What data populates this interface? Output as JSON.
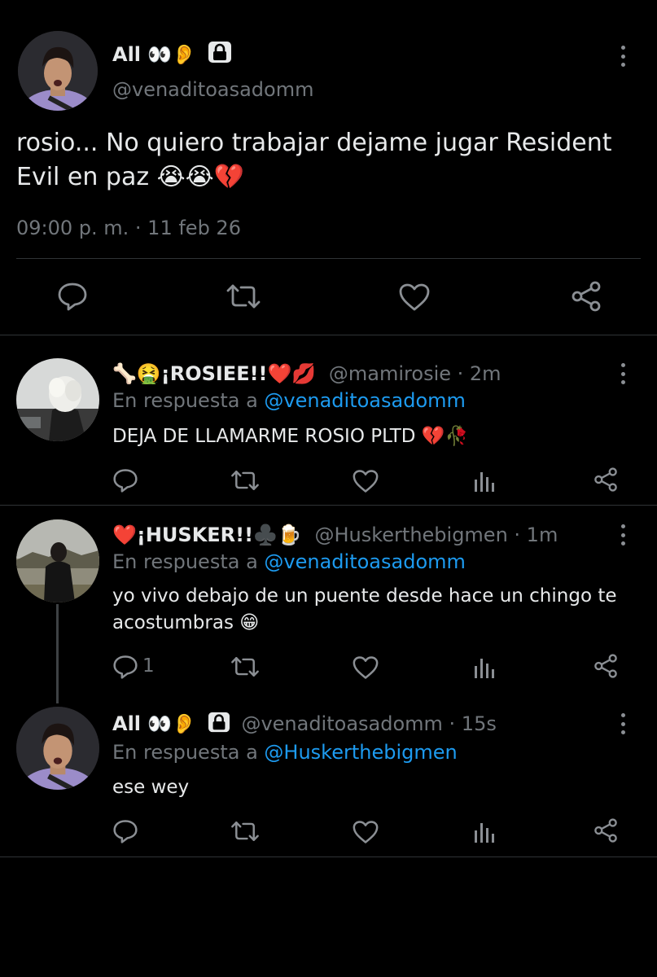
{
  "main_tweet": {
    "display_name": "All 👀👂",
    "lock_icon": "lock-icon",
    "handle": "@venaditoasadomm",
    "text_line1": "rosio... No quiero trabajar dejame jugar Resident",
    "text_line2": "Evil en paz 😭😭💔",
    "timestamp": "09:00 p. m. · 11 feb 26",
    "actions": [
      "reply-icon",
      "retweet-icon",
      "like-icon",
      "share-icon"
    ]
  },
  "replies": [
    {
      "display_name": "🦴🤮¡ROSIEE!!❤️💋",
      "handle_time": "@mamirosie · 2m",
      "reply_prefix": "En respuesta a",
      "reply_to": "@venaditoasadomm",
      "text": "DEJA DE LLAMARME ROSIO PLTD 💔🥀",
      "reply_count": ""
    },
    {
      "display_name": "❤️¡HUSKER!!♣️🍺",
      "handle_time": "@Huskerthebigmen · 1m",
      "reply_prefix": "En respuesta a",
      "reply_to": "@venaditoasadomm",
      "text_line1": "yo vivo debajo de un puente desde hace un chingo te",
      "text_line2": "acostumbras 😁",
      "reply_count": "1"
    },
    {
      "display_name": "All 👀👂",
      "handle_time": "@venaditoasadomm · 15s",
      "reply_prefix": "En respuesta a",
      "reply_to": "@Huskerthebigmen",
      "text": "ese wey",
      "reply_count": ""
    }
  ],
  "colors": {
    "background": "#000000",
    "link": "#1d9bf0",
    "secondary": "#71767b",
    "divider": "#2f3336"
  }
}
